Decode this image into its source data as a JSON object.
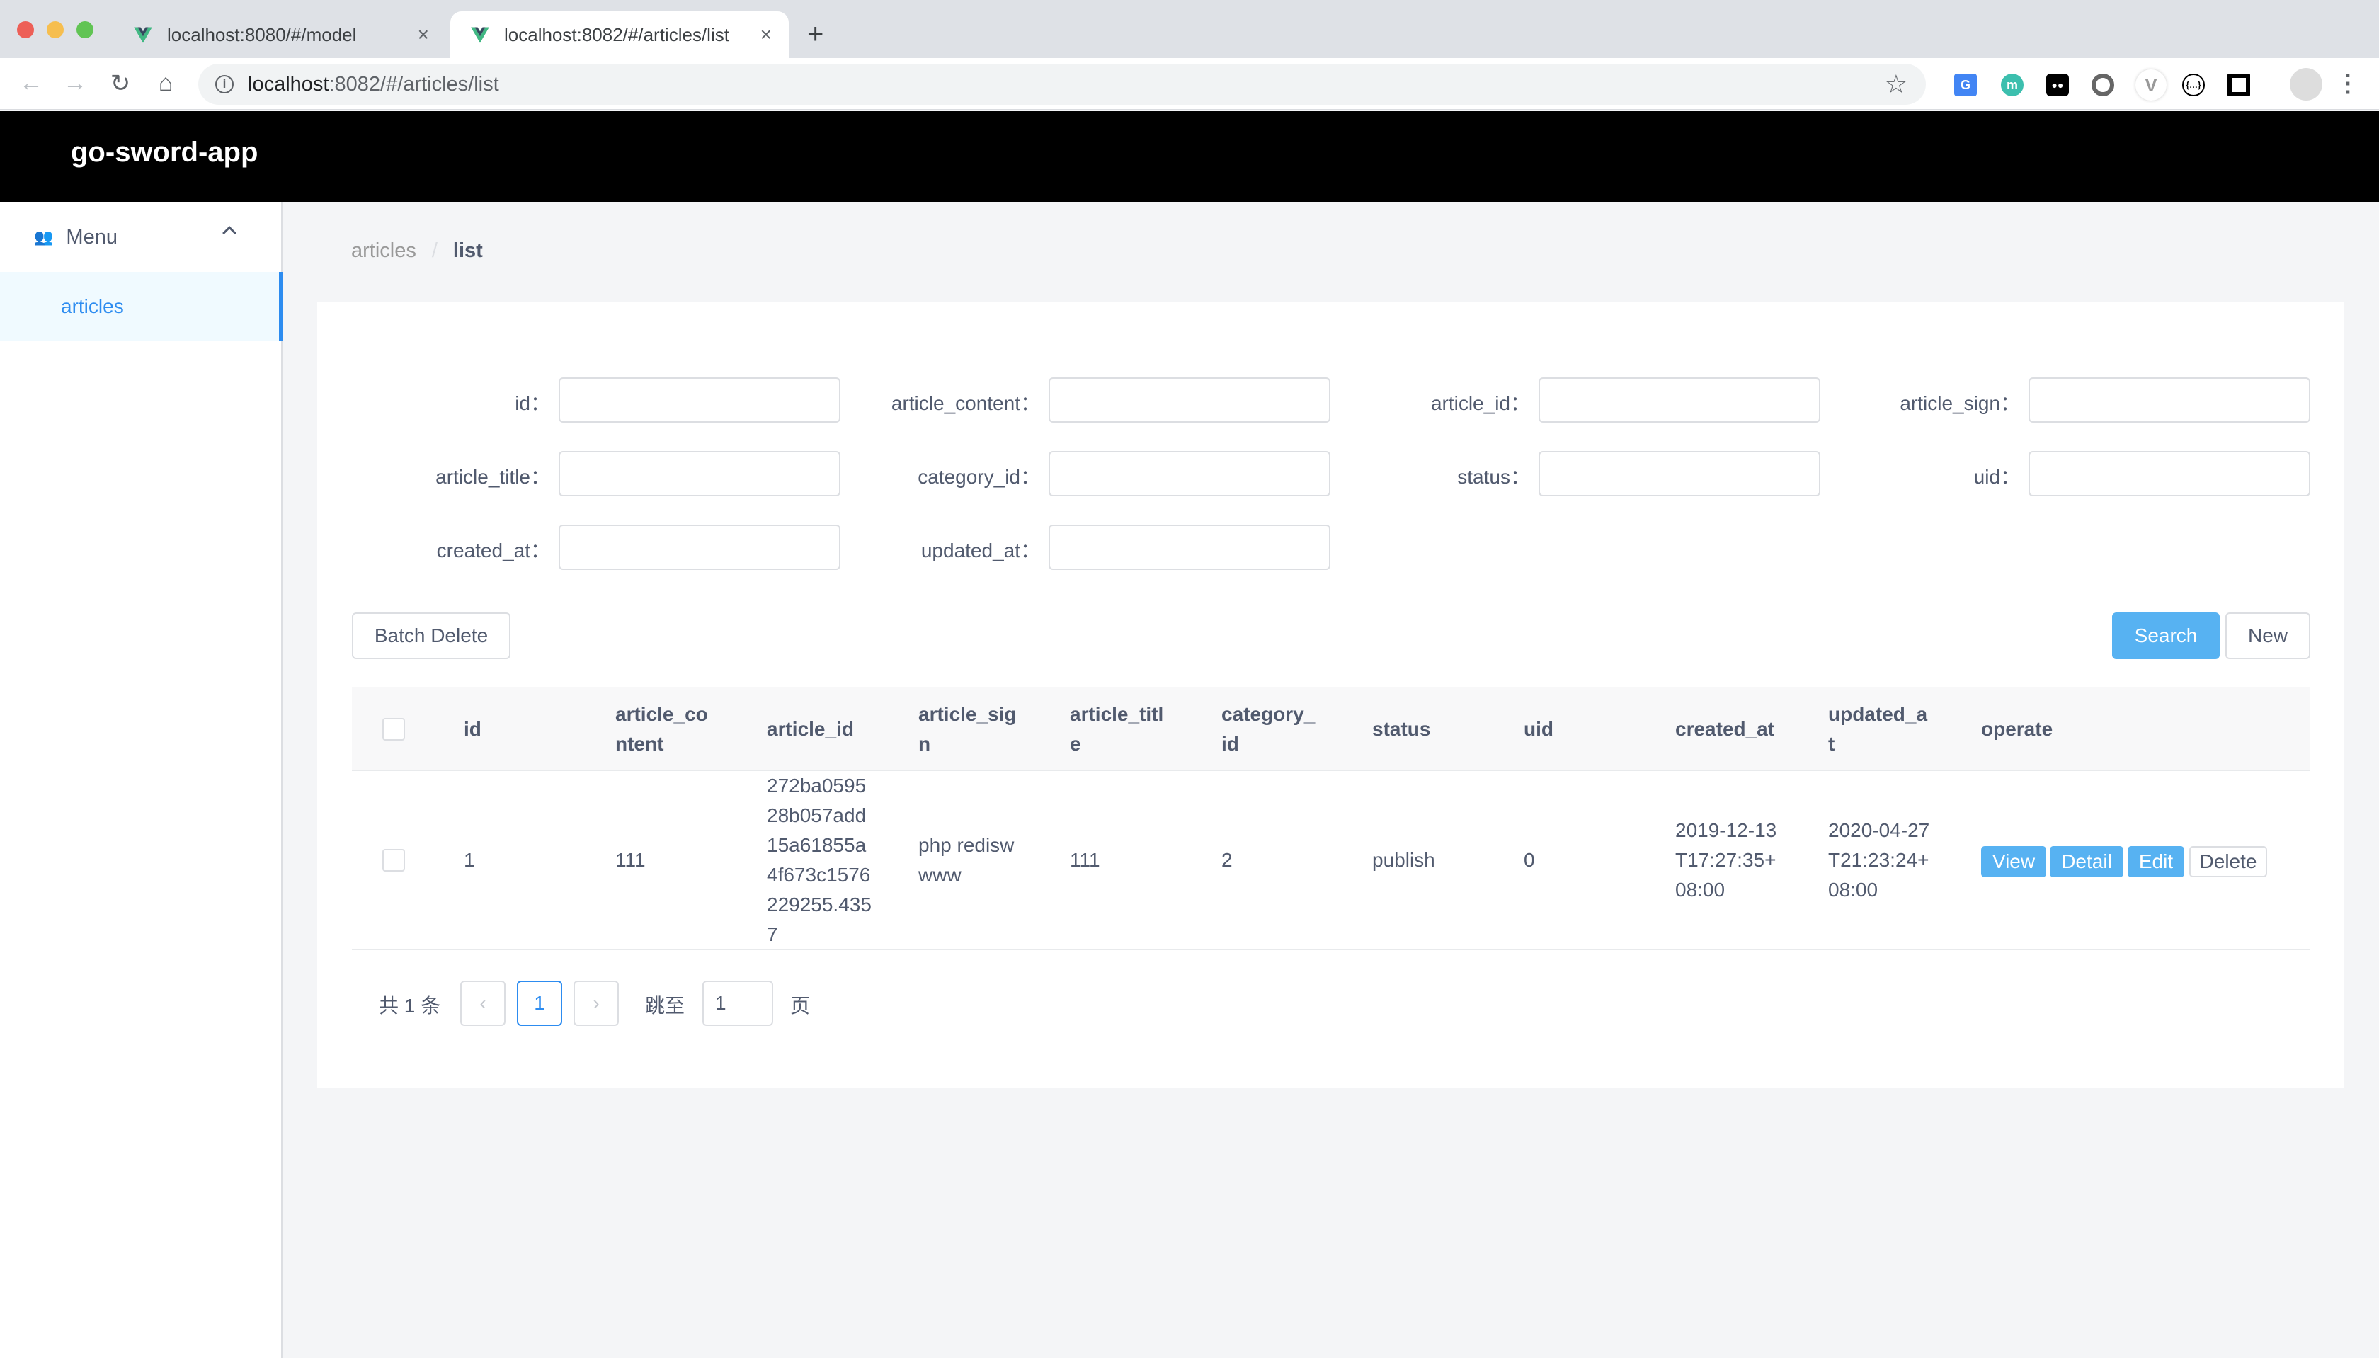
{
  "browser": {
    "tabs": [
      {
        "title": "localhost:8080/#/model",
        "active": false
      },
      {
        "title": "localhost:8082/#/articles/list",
        "active": true
      }
    ],
    "url_host": "localhost",
    "url_rest": ":8082/#/articles/list",
    "extensions": [
      "google-translate-icon",
      "mercury-icon",
      "tampermonkey-icon",
      "circle-extension-icon",
      "vue-devtools-icon",
      "json-viewer-icon",
      "square-extension-icon"
    ]
  },
  "app": {
    "title": "go-sword-app"
  },
  "sidebar": {
    "menu_label": "Menu",
    "items": [
      {
        "label": "articles",
        "active": true
      }
    ]
  },
  "breadcrumb": {
    "items": [
      "articles",
      "list"
    ],
    "separator": "/"
  },
  "search_form": {
    "fields": [
      {
        "label": "id：",
        "value": ""
      },
      {
        "label": "article_content：",
        "value": ""
      },
      {
        "label": "article_id：",
        "value": ""
      },
      {
        "label": "article_sign：",
        "value": ""
      },
      {
        "label": "article_title：",
        "value": ""
      },
      {
        "label": "category_id：",
        "value": ""
      },
      {
        "label": "status：",
        "value": ""
      },
      {
        "label": "uid：",
        "value": ""
      },
      {
        "label": "created_at：",
        "value": ""
      },
      {
        "label": "updated_at：",
        "value": ""
      }
    ]
  },
  "actions": {
    "batch_delete": "Batch Delete",
    "search": "Search",
    "new": "New"
  },
  "table": {
    "columns": [
      "id",
      "article_content",
      "article_id",
      "article_sign",
      "article_title",
      "category_id",
      "status",
      "uid",
      "created_at",
      "updated_at",
      "operate"
    ],
    "rows": [
      {
        "id": "1",
        "article_content": "111",
        "article_id": "272ba059528b057add15a61855a4f673c1576229255.4357",
        "article_sign": "php rediswwww",
        "article_title": "111",
        "category_id": "2",
        "status": "publish",
        "uid": "0",
        "created_at": "2019-12-13T17:27:35+08:00",
        "updated_at": "2020-04-27T21:23:24+08:00",
        "operations": [
          "View",
          "Detail",
          "Edit",
          "Delete"
        ]
      }
    ]
  },
  "pagination": {
    "total_text": "共 1 条",
    "pages": [
      "1"
    ],
    "current_page": "1",
    "prev_icon": "‹",
    "next_icon": "›",
    "jump_label": "跳至",
    "jump_value": "1",
    "page_suffix": "页"
  },
  "colors": {
    "primary": "#57b2f2",
    "active_link": "#2d8cf0",
    "header_bg": "#000000"
  }
}
